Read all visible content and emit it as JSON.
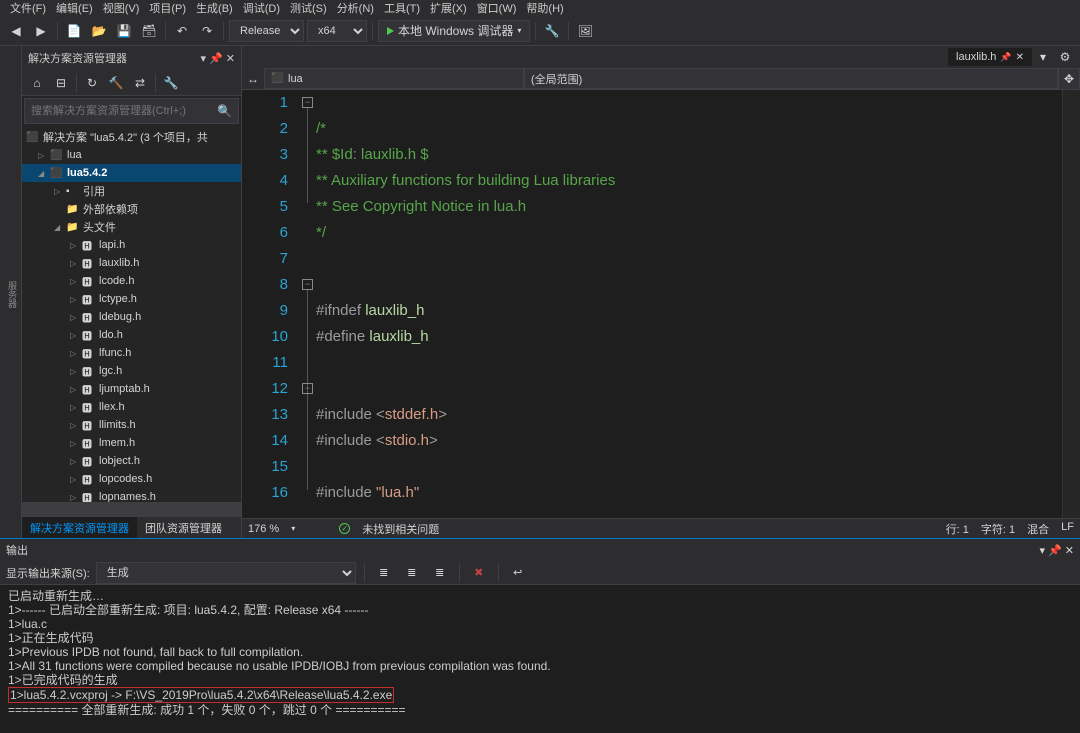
{
  "menubar": [
    "文件(F)",
    "编辑(E)",
    "视图(V)",
    "项目(P)",
    "生成(B)",
    "调试(D)",
    "测试(S)",
    "分析(N)",
    "工具(T)",
    "扩展(X)",
    "窗口(W)",
    "帮助(H)"
  ],
  "toolbar": {
    "config": "Release",
    "platform": "x64",
    "debugger": "本地 Windows 调试器"
  },
  "sidebar": {
    "title": "解决方案资源管理器",
    "search_placeholder": "搜索解决方案资源管理器(Ctrl+;)",
    "solution_label": "解决方案 \"lua5.4.2\" (3 个项目，共",
    "nodes": {
      "lua": "lua",
      "lua542": "lua5.4.2",
      "refs": "引用",
      "external": "外部依赖项",
      "headers": "头文件"
    },
    "files": [
      "lapi.h",
      "lauxlib.h",
      "lcode.h",
      "lctype.h",
      "ldebug.h",
      "ldo.h",
      "lfunc.h",
      "lgc.h",
      "ljumptab.h",
      "llex.h",
      "llimits.h",
      "lmem.h",
      "lobject.h",
      "lopcodes.h",
      "lopnames.h"
    ],
    "tabs": {
      "active": "解决方案资源管理器",
      "other": "团队资源管理器"
    }
  },
  "editor": {
    "tab": "lauxlib.h",
    "nav_left": "lua",
    "nav_right": "(全局范围)",
    "lines": {
      "l1": "/*",
      "l2": "** $Id: lauxlib.h $",
      "l3": "** Auxiliary functions for building Lua libraries",
      "l4": "** See Copyright Notice in lua.h",
      "l5": "*/",
      "l8a": "#ifndef ",
      "l8b": "lauxlib_h",
      "l9a": "#define ",
      "l9b": "lauxlib_h",
      "l12a": "#include ",
      "l12b": "<stddef.h>",
      "l13a": "#include ",
      "l13b": "<stdio.h>",
      "l15a": "#include ",
      "l15b": "\"lua.h\""
    },
    "zoom": "176 %",
    "issues": "未找到相关问题",
    "status": {
      "line": "行: 1",
      "col": "字符: 1",
      "mode": "混合",
      "ending": "LF"
    }
  },
  "output": {
    "title": "输出",
    "source_label": "显示输出来源(S):",
    "source_value": "生成",
    "lines": [
      "已启动重新生成…",
      "1>------ 已启动全部重新生成: 项目: lua5.4.2, 配置: Release x64 ------",
      "1>lua.c",
      "1>正在生成代码",
      "1>Previous IPDB not found, fall back to full compilation.",
      "1>All 31 functions were compiled because no usable IPDB/IOBJ from previous compilation was found.",
      "1>已完成代码的生成",
      "1>lua5.4.2.vcxproj -> F:\\VS_2019Pro\\lua5.4.2\\x64\\Release\\lua5.4.2.exe",
      "========== 全部重新生成: 成功 1 个，失败 0 个，跳过 0 个 =========="
    ]
  }
}
